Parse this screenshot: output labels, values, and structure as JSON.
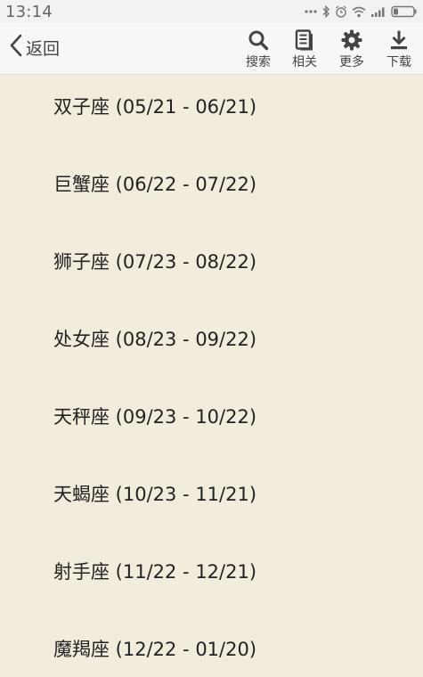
{
  "status_bar": {
    "time": "13:14"
  },
  "toolbar": {
    "back_label": "返回",
    "search_label": "搜索",
    "related_label": "相关",
    "more_label": "更多",
    "download_label": "下载"
  },
  "zodiac_list": [
    {
      "label": "双子座 (05/21 - 06/21)"
    },
    {
      "label": "巨蟹座 (06/22 - 07/22)"
    },
    {
      "label": "狮子座 (07/23 - 08/22)"
    },
    {
      "label": "处女座 (08/23 - 09/22)"
    },
    {
      "label": "天秤座 (09/23 - 10/22)"
    },
    {
      "label": "天蝎座 (10/23 - 11/21)"
    },
    {
      "label": "射手座 (11/22 - 12/21)"
    },
    {
      "label": "魔羯座 (12/22 - 01/20)"
    }
  ],
  "icons": {
    "back": "chevron-left-icon",
    "search": "search-icon",
    "related": "document-icon",
    "more": "gear-icon",
    "download": "download-icon"
  },
  "colors": {
    "background": "#f2ecdc",
    "toolbar": "#f7f7f7",
    "text": "#222222"
  }
}
